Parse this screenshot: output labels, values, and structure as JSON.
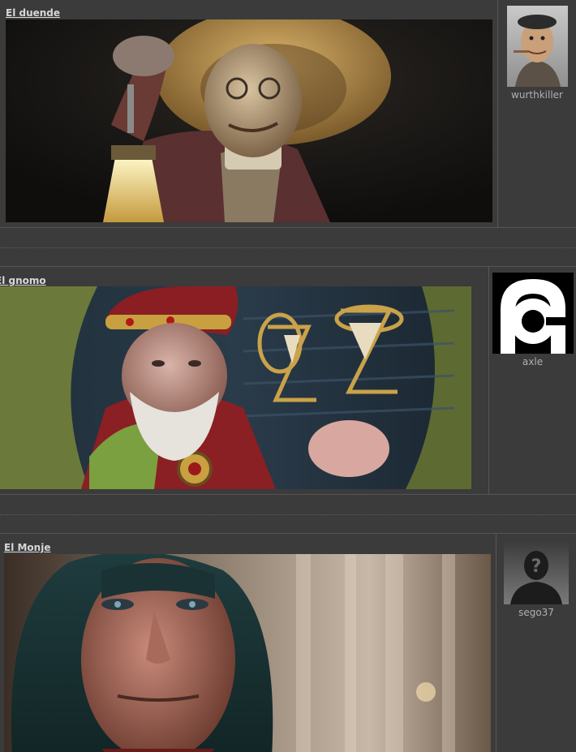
{
  "posts": [
    {
      "title": "El duende",
      "author": "wurthkiller",
      "avatar_icon": "character-portrait-avatar"
    },
    {
      "title": "El gnomo",
      "author": "axle",
      "avatar_icon": "abstract-logo-avatar"
    },
    {
      "title": "El Monje",
      "author": "sego37",
      "avatar_icon": "default-user-silhouette-avatar"
    }
  ],
  "colors": {
    "background": "#3b3b3b",
    "title": "#d7d7d7",
    "username": "#b0b0b0"
  }
}
